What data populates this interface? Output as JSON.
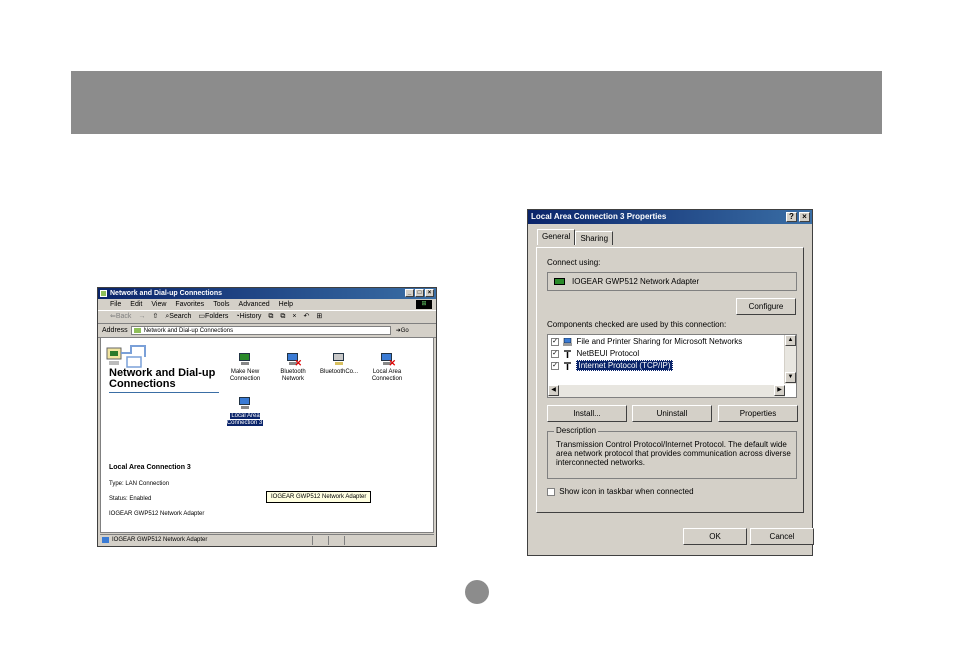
{
  "explorer": {
    "title": "Network and Dial-up Connections",
    "menu": [
      "File",
      "Edit",
      "View",
      "Favorites",
      "Tools",
      "Advanced",
      "Help"
    ],
    "toolbar": {
      "back": "⇐Back",
      "forward": "→",
      "search": "Search",
      "folders": "Folders",
      "history": "History"
    },
    "address_label": "Address",
    "address_value": "Network and Dial-up Connections",
    "go_label": "Go",
    "folder_title": "Network and Dial-up Connections",
    "selected_name": "Local Area Connection 3",
    "type_line": "Type: LAN Connection",
    "status_line": "Status: Enabled",
    "adapter_line": "IOGEAR GWP512 Network Adapter",
    "icons": [
      {
        "label": "Make New Connection",
        "icon": "make-new-connection-icon"
      },
      {
        "label": "Bluetooth Network",
        "icon": "disconnected-network-icon"
      },
      {
        "label": "BluetoothCo...",
        "icon": "bluetooth-connection-icon"
      },
      {
        "label": "Local Area Connection",
        "icon": "disconnected-network-icon"
      },
      {
        "label": "Local Area Connection 3",
        "icon": "lan-connection-icon"
      }
    ],
    "tooltip": "IOGEAR GWP512 Network Adapter",
    "status_bar": "IOGEAR GWP512 Network Adapter"
  },
  "dialog": {
    "title": "Local Area Connection 3 Properties",
    "help_btn": "?",
    "close_btn": "×",
    "tabs": [
      "General",
      "Sharing"
    ],
    "connect_using_label": "Connect using:",
    "adapter": "IOGEAR GWP512 Network Adapter",
    "configure_label": "Configure",
    "components_label": "Components checked are used by this connection:",
    "components": [
      {
        "label": "File and Printer Sharing for Microsoft Networks",
        "checked": true
      },
      {
        "label": "NetBEUI Protocol",
        "checked": true
      },
      {
        "label": "Internet Protocol (TCP/IP)",
        "checked": true,
        "selected": true
      }
    ],
    "install_label": "Install...",
    "uninstall_label": "Uninstall",
    "properties_label": "Properties",
    "description_legend": "Description",
    "description_text": "Transmission Control Protocol/Internet Protocol. The default wide area network protocol that provides communication across diverse interconnected networks.",
    "show_icon_label": "Show icon in taskbar when connected",
    "show_icon_checked": false,
    "ok_label": "OK",
    "cancel_label": "Cancel"
  },
  "colors": {
    "banner": "#8c8c8c",
    "titlebar": "#0a246a",
    "selection": "#0a246a",
    "face": "#d4d0c8"
  }
}
